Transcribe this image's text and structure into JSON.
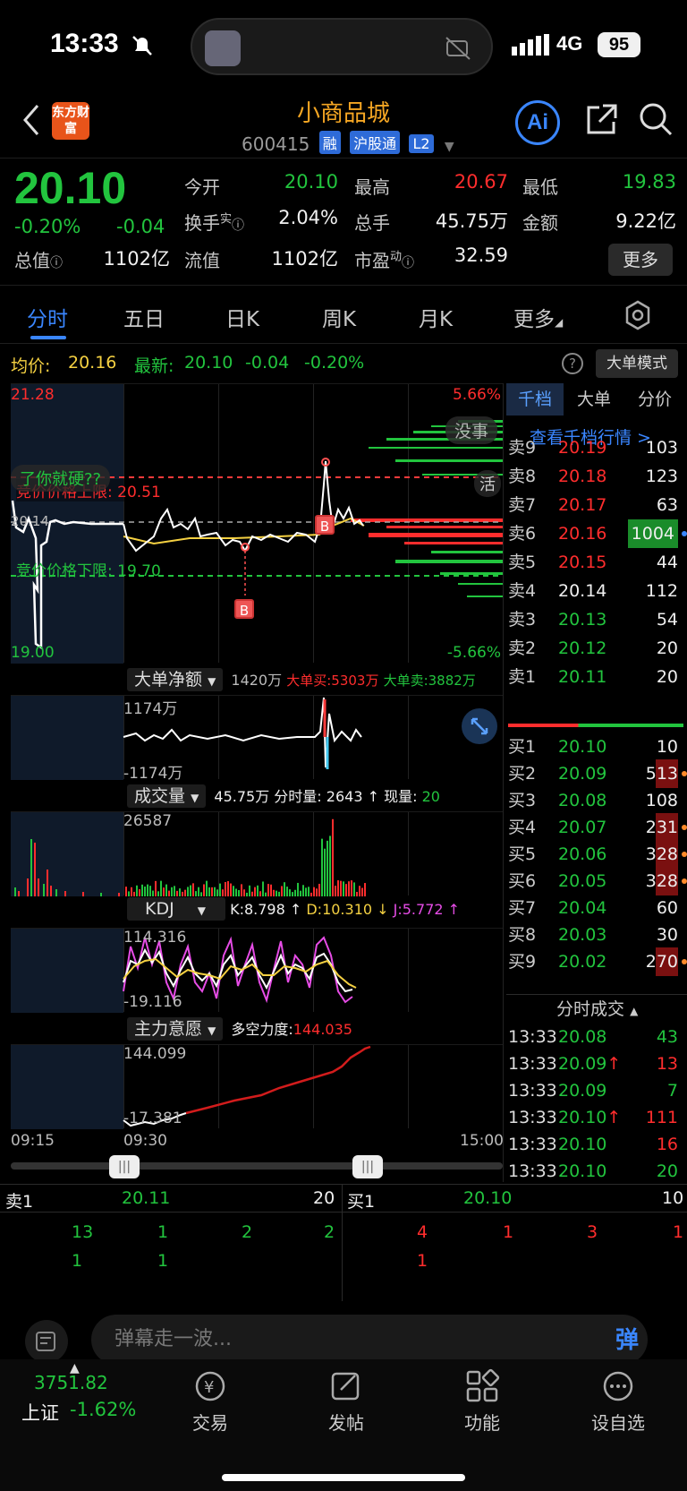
{
  "status_bar": {
    "time": "13:33",
    "network": "4G",
    "battery": "95"
  },
  "header": {
    "title": "小商品城",
    "code": "600415",
    "tags": [
      "融",
      "沪股通",
      "L2"
    ],
    "logo_text": "东方财富",
    "ai_label": "Ai"
  },
  "quote": {
    "price": "20.10",
    "change_pct": "-0.20%",
    "change": "-0.04",
    "open_label": "今开",
    "open": "20.10",
    "high_label": "最高",
    "high": "20.67",
    "low_label": "最低",
    "low": "19.83",
    "turnover_label": "换手",
    "turnover_sup": "实",
    "turnover": "2.04%",
    "volume_label": "总手",
    "volume": "45.75万",
    "amount_label": "金额",
    "amount": "9.22亿",
    "mktcap_label": "总值",
    "mktcap": "1102亿",
    "float_label": "流值",
    "float": "1102亿",
    "pe_label": "市盈",
    "pe_sup": "动",
    "pe": "32.59",
    "more_label": "更多"
  },
  "tabs": [
    "分时",
    "五日",
    "日K",
    "周K",
    "月K",
    "更多"
  ],
  "info_line": {
    "avg_label": "均价:",
    "avg": "20.16",
    "latest_label": "最新:",
    "latest": "20.10",
    "chg": "-0.04",
    "pct": "-0.20%",
    "big_mode": "大单模式"
  },
  "main_chart": {
    "y_top": "21.28",
    "y_bottom": "19.00",
    "y_mid": "20.14",
    "pct_top": "5.66%",
    "pct_bottom": "-5.66%",
    "upper_limit_label": "竞价价格上限:",
    "upper_limit": "20.51",
    "lower_limit_label": "竞价价格下限:",
    "lower_limit": "19.70",
    "danmu1": "没事",
    "danmu2": "了你就硬??",
    "danmu3": "活",
    "marker": "B"
  },
  "big_order": {
    "label": "大单净额",
    "net": "1420万",
    "buy_label": "大单买:",
    "buy": "5303万",
    "sell_label": "大单卖:",
    "sell": "3882万",
    "y_top": "1174万",
    "y_bottom": "-1174万"
  },
  "volume_panel": {
    "label": "成交量",
    "total": "45.75万",
    "minute_label": "分时量:",
    "minute": "2643",
    "now_label": "现量:",
    "now": "20",
    "y_top": "26587"
  },
  "kdj": {
    "label": "KDJ",
    "k": "K:8.798 ↑",
    "d": "D:10.310 ↓",
    "j": "J:5.772 ↑",
    "y_top": "114.316",
    "y_bottom": "-19.116"
  },
  "main_force": {
    "label": "主力意愿",
    "power_label": "多空力度:",
    "power": "144.035",
    "y_top": "144.099",
    "y_bottom": "-17.381"
  },
  "time_axis": [
    "09:15",
    "09:30",
    "15:00"
  ],
  "book": {
    "tabs": [
      "千档",
      "大单",
      "分价"
    ],
    "link": "查看千档行情 >",
    "asks": [
      {
        "label": "卖9",
        "price": "20.19",
        "vol": "103"
      },
      {
        "label": "卖8",
        "price": "20.18",
        "vol": "123"
      },
      {
        "label": "卖7",
        "price": "20.17",
        "vol": "63"
      },
      {
        "label": "卖6",
        "price": "20.16",
        "vol": "1004"
      },
      {
        "label": "卖5",
        "price": "20.15",
        "vol": "44"
      },
      {
        "label": "卖4",
        "price": "20.14",
        "vol": "112"
      },
      {
        "label": "卖3",
        "price": "20.13",
        "vol": "54"
      },
      {
        "label": "卖2",
        "price": "20.12",
        "vol": "20"
      },
      {
        "label": "卖1",
        "price": "20.11",
        "vol": "20"
      }
    ],
    "bids": [
      {
        "label": "买1",
        "price": "20.10",
        "vol": "10"
      },
      {
        "label": "买2",
        "price": "20.09",
        "vol": "513"
      },
      {
        "label": "买3",
        "price": "20.08",
        "vol": "108"
      },
      {
        "label": "买4",
        "price": "20.07",
        "vol": "231"
      },
      {
        "label": "买5",
        "price": "20.06",
        "vol": "328"
      },
      {
        "label": "买6",
        "price": "20.05",
        "vol": "328"
      },
      {
        "label": "买7",
        "price": "20.04",
        "vol": "60"
      },
      {
        "label": "买8",
        "price": "20.03",
        "vol": "30"
      },
      {
        "label": "买9",
        "price": "20.02",
        "vol": "270"
      }
    ],
    "ticks_label": "分时成交",
    "ticks": [
      {
        "t": "13:33",
        "p": "20.08",
        "v": "43"
      },
      {
        "t": "13:33",
        "p": "20.09↑",
        "v": "13"
      },
      {
        "t": "13:33",
        "p": "20.09",
        "v": "7"
      },
      {
        "t": "13:33",
        "p": "20.10↑",
        "v": "111"
      },
      {
        "t": "13:33",
        "p": "20.10",
        "v": "16"
      },
      {
        "t": "13:33",
        "p": "20.10",
        "v": "20"
      }
    ]
  },
  "level1": {
    "sell_label": "卖1",
    "sell_price": "20.11",
    "sell_vol": "20",
    "buy_label": "买1",
    "buy_price": "20.10",
    "buy_vol": "10",
    "sell_queue": [
      [
        "13",
        "1",
        "2",
        "2"
      ],
      [
        "1",
        "1"
      ]
    ],
    "buy_queue": [
      [
        "4",
        "1",
        "3",
        "1"
      ],
      [
        "1"
      ]
    ]
  },
  "danmu_placeholder": "弹幕走一波...",
  "danmu_btn": "弹",
  "nav": {
    "index_value": "3751.82",
    "index_name": "上证",
    "index_pct": "-1.62%",
    "items": [
      "交易",
      "发帖",
      "功能",
      "设自选"
    ]
  }
}
